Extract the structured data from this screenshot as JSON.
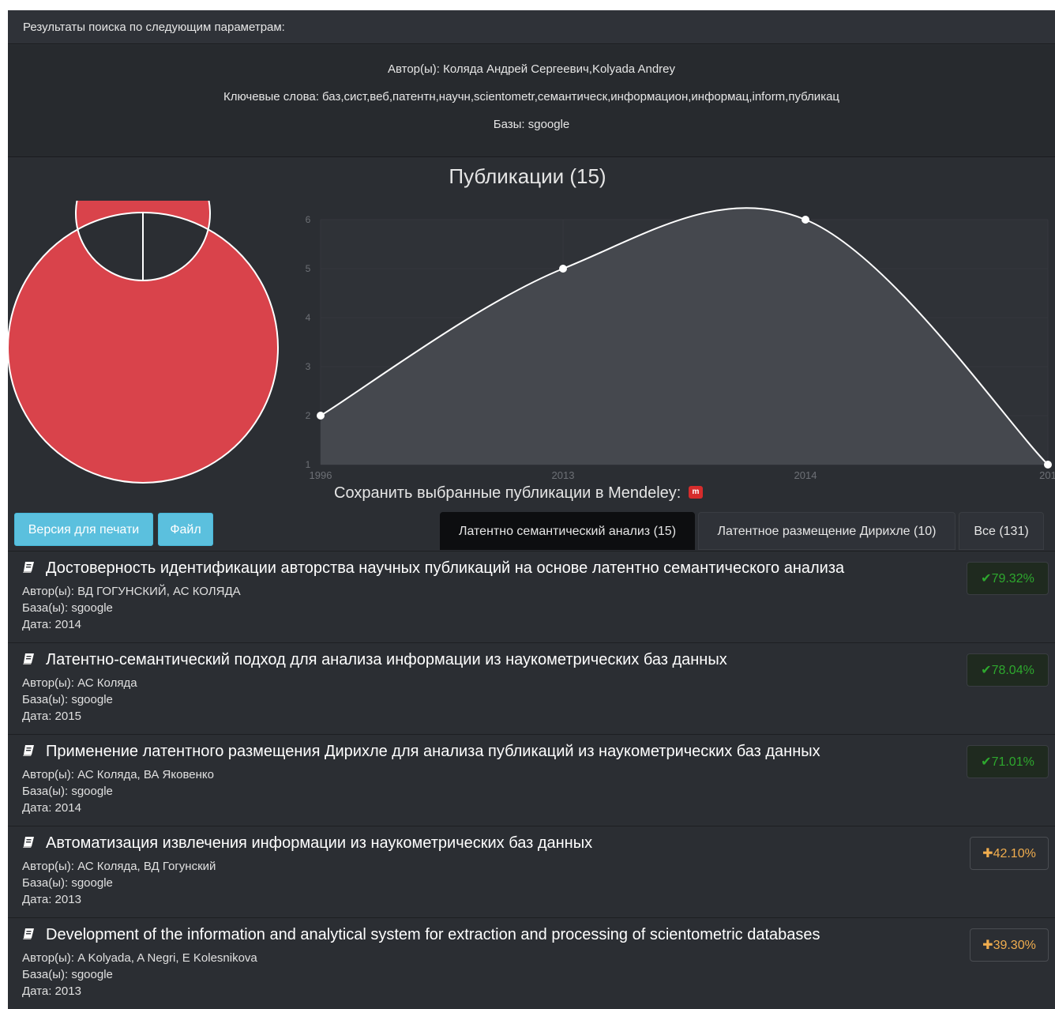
{
  "params": {
    "header": "Результаты поиска по следующим параметрам:",
    "authors": "Автор(ы): Коляда Андрей Сергеевич,Kolyada Andrey",
    "keywords": "Ключевые слова: баз,сист,веб,патентн,научн,scientometr,семантическ,информацион,информац,inform,публикац",
    "bases": "Базы: sgoogle"
  },
  "chart_title": "Публикации (15)",
  "colors": {
    "accent_red": "#d9434b",
    "score_green": "#2ea82e",
    "score_orange": "#f0ad4e",
    "tab_active": "#0d0e10"
  },
  "chart_data": [
    {
      "type": "pie",
      "variant": "donut",
      "categories": [
        ""
      ],
      "values": [
        15
      ],
      "colors": [
        "#d9434b"
      ]
    },
    {
      "type": "area",
      "x": [
        "1996",
        "2013",
        "2014",
        "201"
      ],
      "series": [
        {
          "values": [
            2,
            5,
            6,
            1
          ]
        }
      ],
      "ylim": [
        1,
        6
      ],
      "yticks": [
        "1",
        "2",
        "3",
        "4",
        "5",
        "6"
      ],
      "xticks": [
        "1996",
        "2013",
        "2014",
        "201"
      ],
      "grid": true
    }
  ],
  "mendeley": {
    "label": "Сохранить выбранные публикации в Mendeley:",
    "icon": "mendeley-icon"
  },
  "buttons": {
    "print": "Версия для печати",
    "file": "Файл"
  },
  "tabs": [
    {
      "label": "Латентно семантический анализ (15)",
      "active": true
    },
    {
      "label": "Латентное размещение Дирихле (10)",
      "active": false
    },
    {
      "label": "Все (131)",
      "active": false
    }
  ],
  "publications": [
    {
      "title": "Достоверность идентификации авторства научных публикаций на основе латентно семантического анализа",
      "authors": "Автор(ы): ВД ГОГУНСКИЙ, АС КОЛЯДА",
      "bases": "База(ы): sgoogle",
      "date": "Дата: 2014",
      "score": "✔79.32%",
      "score_type": "green"
    },
    {
      "title": "Латентно-семантический подход для анализа информации из наукометрических баз данных",
      "authors": "Автор(ы): АС Коляда",
      "bases": "База(ы): sgoogle",
      "date": "Дата: 2015",
      "score": "✔78.04%",
      "score_type": "green"
    },
    {
      "title": "Применение латентного размещения Дирихле для анализа публикаций из наукометрических баз данных",
      "authors": "Автор(ы): АС Коляда, ВА Яковенко",
      "bases": "База(ы): sgoogle",
      "date": "Дата: 2014",
      "score": "✔71.01%",
      "score_type": "green"
    },
    {
      "title": "Автоматизация извлечения информации из наукометрических баз данных",
      "authors": "Автор(ы): АС Коляда, ВД Гогунский",
      "bases": "База(ы): sgoogle",
      "date": "Дата: 2013",
      "score": "✚42.10%",
      "score_type": "orange"
    },
    {
      "title": "Development of the information and analytical system for extraction and processing of scientometric databases",
      "authors": "Автор(ы): A Kolyada, A Negri, E Kolesnikova",
      "bases": "База(ы): sgoogle",
      "date": "Дата: 2013",
      "score": "✚39.30%",
      "score_type": "orange"
    }
  ]
}
